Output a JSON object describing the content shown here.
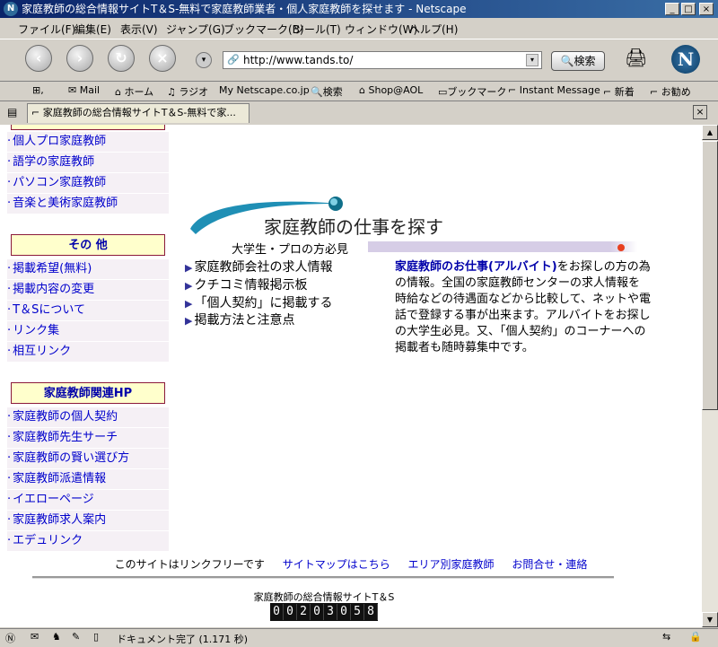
{
  "window": {
    "title": "家庭教師の総合情報サイトT＆S-無料で家庭教師業者・個人家庭教師を探せます - Netscape"
  },
  "menu": [
    "ファイル(F)",
    "編集(E)",
    "表示(V)",
    "ジャンプ(G)",
    "ブックマーク(B)",
    "ツール(T)",
    "ウィンドウ(W)",
    "ヘルプ(H)"
  ],
  "toolbar": {
    "url": "http://www.tands.to/",
    "search_label": "検索"
  },
  "personal_bar": [
    "Mail",
    "ホーム",
    "ラジオ",
    "Netscape.co.jp",
    "検索",
    "Shop@AOL",
    "ブックマーク",
    "Instant Message",
    "新着",
    "お勧め"
  ],
  "tab": {
    "label": "家庭教師の総合情報サイトT＆S-無料で家..."
  },
  "sidebar": {
    "top_links": [
      "個人プロ家庭教師",
      "語学の家庭教師",
      "パソコン家庭教師",
      "音楽と美術家庭教師"
    ],
    "other_header": "その 他",
    "other_links": [
      "掲載希望(無料)",
      "掲載内容の変更",
      "T＆Sについて",
      "リンク集",
      "相互リンク"
    ],
    "related_header": "家庭教師関連HP",
    "related_links": [
      "家庭教師の個人契約",
      "家庭教師先生サーチ",
      "家庭教師の賢い選び方",
      "家庭教師派遣情報",
      "イエローページ",
      "家庭教師求人案内",
      "エデュリンク"
    ]
  },
  "main": {
    "banner_title": "家庭教師の仕事を探す",
    "banner_sub": "大学生・プロの方必見",
    "links": [
      "家庭教師会社の求人情報",
      "クチコミ情報掲示板",
      "「個人契約」に掲載する",
      "掲載方法と注意点"
    ],
    "desc_highlight": "家庭教師のお仕事(アルバイト)",
    "desc_text": "をお探しの方の為の情報。全国の家庭教師センターの求人情報を時給などの待遇面などから比較して、ネットや電話で登録する事が出来ます。アルバイトをお探しの大学生必見。又、「個人契約」のコーナーへの掲載者も随時募集中です。"
  },
  "footer": {
    "linkfree": "このサイトはリンクフリーです",
    "links": [
      "サイトマップはこちら",
      "エリア別家庭教師",
      "お問合せ・連絡"
    ],
    "site_name": "家庭教師の総合情報サイトT＆S",
    "counter": "00203058"
  },
  "status": {
    "text": "ドキュメント完了 (1.171 秒)"
  },
  "colors": {
    "link": "#0000cc",
    "header_border": "#8b1a3a",
    "header_bg": "#ffffcc",
    "title_gradient_start": "#0a246a"
  }
}
